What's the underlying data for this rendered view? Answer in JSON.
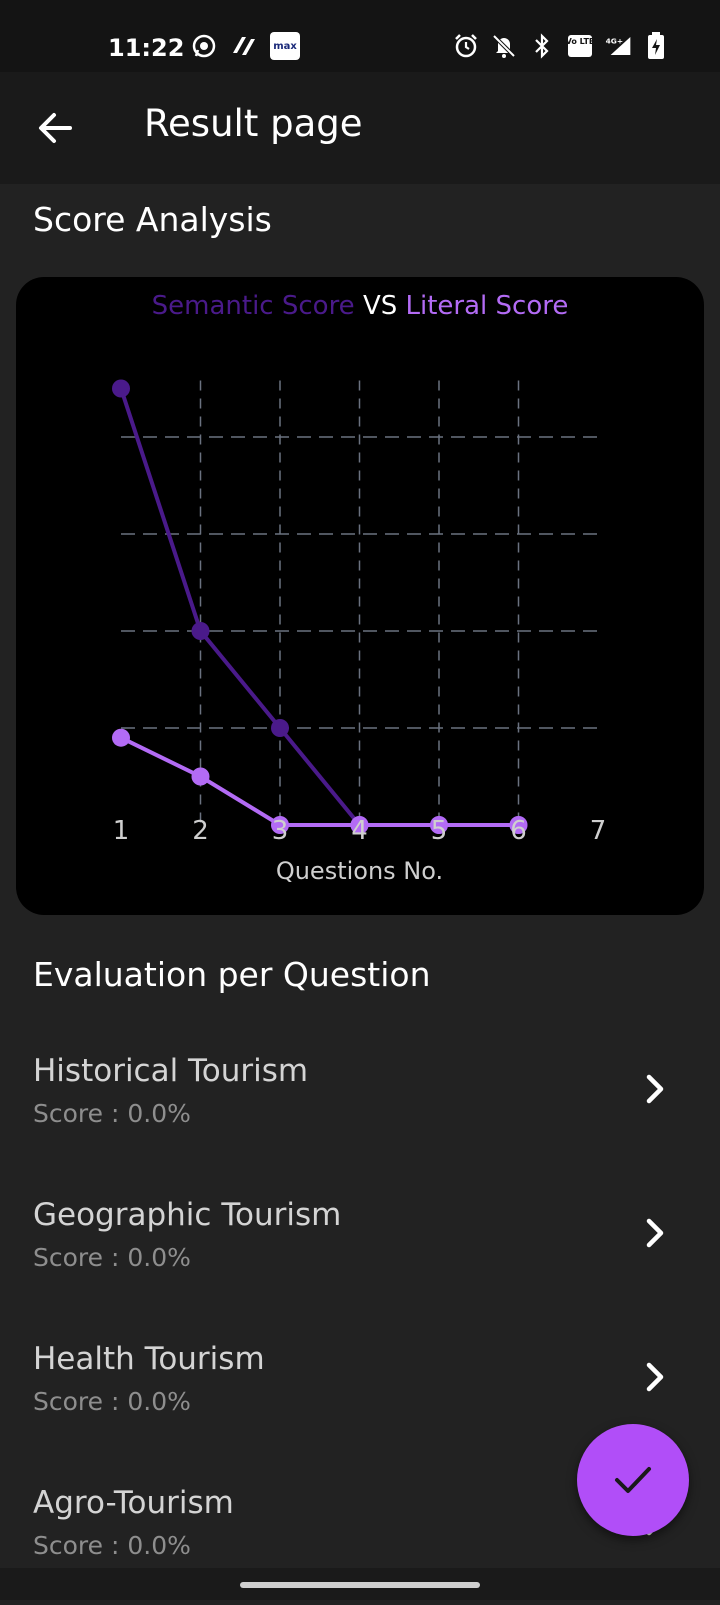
{
  "status_bar": {
    "time": "11:22",
    "left_icons": [
      "whatsapp-icon",
      "app-icon",
      "max-icon"
    ],
    "max_badge": "max",
    "right_icons": [
      "alarm-icon",
      "notifications-off-icon",
      "bluetooth-icon",
      "volte-icon",
      "signal-4g-icon",
      "battery-charging-icon"
    ],
    "volte_text": "Vo LTE",
    "network_text": "4G+"
  },
  "app_bar": {
    "back_icon": "arrow-back-icon",
    "title": "Result page"
  },
  "score_analysis": {
    "heading": "Score Analysis",
    "legend": {
      "semantic": "Semantic Score",
      "vs": "VS",
      "literal": "Literal Score"
    }
  },
  "chart_data": {
    "type": "line",
    "x": [
      1,
      2,
      3,
      4,
      5,
      6
    ],
    "x_ticks": [
      "1",
      "2",
      "3",
      "4",
      "5",
      "6",
      "7"
    ],
    "xlabel": "Questions No.",
    "xlim": [
      1,
      7
    ],
    "ylim": [
      0,
      5
    ],
    "grid": "dashed",
    "series": [
      {
        "name": "Semantic Score",
        "color": "#4a1a8a",
        "values": [
          4.5,
          2,
          1,
          0,
          0,
          0
        ]
      },
      {
        "name": "Literal Score",
        "color": "#b36bf5",
        "values": [
          0.9,
          0.5,
          0,
          0,
          0,
          0
        ]
      }
    ]
  },
  "evaluation": {
    "heading": "Evaluation per Question",
    "items": [
      {
        "name": "Historical Tourism",
        "score": "Score : 0.0%"
      },
      {
        "name": "Geographic Tourism",
        "score": "Score : 0.0%"
      },
      {
        "name": "Health Tourism",
        "score": "Score : 0.0%"
      },
      {
        "name": "Agro-Tourism",
        "score": "Score : 0.0%"
      }
    ],
    "chevron_icon": "chevron-right-icon"
  },
  "fab": {
    "icon": "check-icon",
    "color": "#b14ef8"
  }
}
